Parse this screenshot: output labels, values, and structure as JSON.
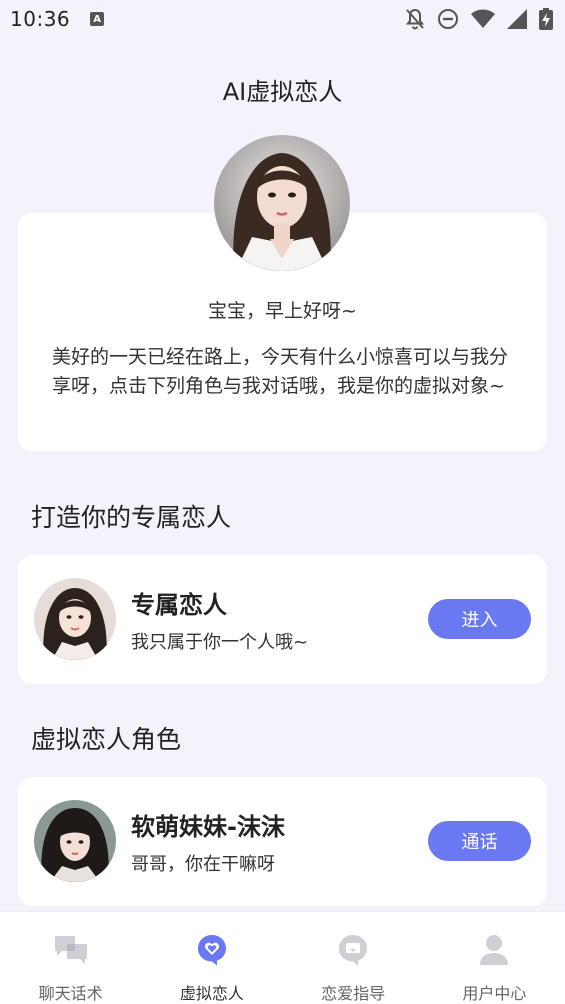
{
  "status_bar": {
    "time": "10:36",
    "app_indicator": "A"
  },
  "page_title": "AI虚拟恋人",
  "intro": {
    "greeting": "宝宝，早上好呀~",
    "text": "美好的一天已经在路上，今天有什么小惊喜可以与我分享呀，点击下列角色与我对话哦，我是你的虚拟对象~"
  },
  "section_exclusive": {
    "title": "打造你的专属恋人",
    "card": {
      "name": "专属恋人",
      "desc": "我只属于你一个人哦~",
      "button": "进入"
    }
  },
  "section_roles": {
    "title": "虚拟恋人角色",
    "card": {
      "name": "软萌妹妹-沫沫",
      "desc": "哥哥，你在干嘛呀",
      "button": "通话"
    }
  },
  "bottom_nav": {
    "items": [
      {
        "label": "聊天话术",
        "icon": "chat-bubbles-icon"
      },
      {
        "label": "虚拟恋人",
        "icon": "heart-chat-icon"
      },
      {
        "label": "恋爱指导",
        "icon": "guide-chat-icon"
      },
      {
        "label": "用户中心",
        "icon": "user-icon"
      }
    ],
    "active_index": 1
  },
  "colors": {
    "accent": "#6a78f2",
    "background": "#f4f3fb",
    "card": "#ffffff",
    "nav_active": "#6a78f2",
    "nav_inactive": "#cfcfd6"
  }
}
